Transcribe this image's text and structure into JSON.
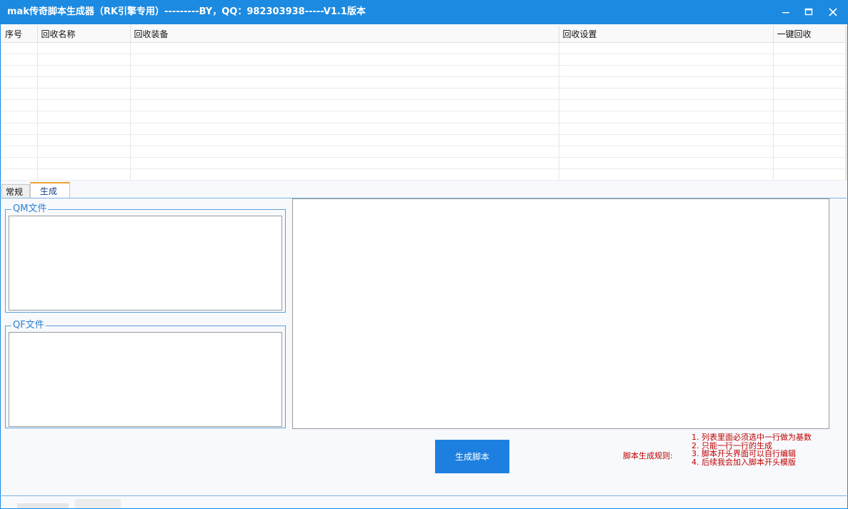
{
  "window": {
    "title": "mak传奇脚本生成器（RK引擎专用）---------BY，QQ：982303938-----V1.1版本"
  },
  "grid": {
    "columns": [
      "序号",
      "回收名称",
      "回收装备",
      "回收设置",
      "一键回收"
    ]
  },
  "tabs": [
    "常规",
    "生成"
  ],
  "active_tab": "生成",
  "qm_group": {
    "label": "QM文件"
  },
  "qf_group": {
    "label": "QF文件"
  },
  "generate_button": {
    "label": "生成脚本"
  },
  "rules": {
    "label": "脚本生成规则:",
    "items": [
      "1. 列表里面必须选中一行做为基数",
      "2. 只能一行一行的生成",
      "3. 脚本开头界面可以自行编辑",
      "4. 后续我会加入脚本开头模版"
    ]
  },
  "colors": {
    "titlebar": "#1c8ae0",
    "button": "#1d80e0",
    "rules_text": "#c00000",
    "group_label": "#2d7fd0"
  }
}
